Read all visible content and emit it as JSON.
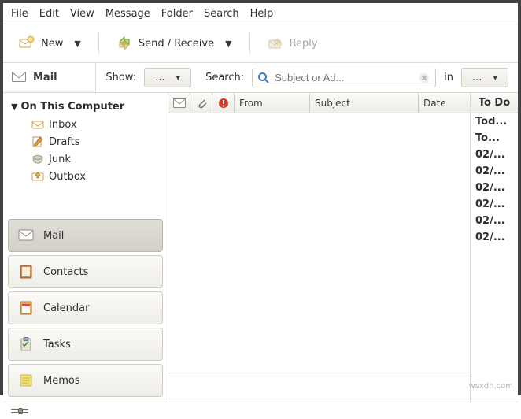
{
  "menu": {
    "file": "File",
    "edit": "Edit",
    "view": "View",
    "message": "Message",
    "folder": "Folder",
    "search": "Search",
    "help": "Help"
  },
  "toolbar": {
    "new": "New",
    "sendreceive": "Send / Receive",
    "reply": "Reply"
  },
  "sidebar_header": "Mail",
  "show_label": "Show:",
  "show_value": "...",
  "search_label": "Search:",
  "search_placeholder": "Subject or Ad...",
  "in_label": "in",
  "in_value": "...",
  "tree": {
    "root": "On This Computer",
    "items": [
      {
        "label": "Inbox"
      },
      {
        "label": "Drafts"
      },
      {
        "label": "Junk"
      },
      {
        "label": "Outbox"
      }
    ]
  },
  "switcher": [
    {
      "label": "Mail"
    },
    {
      "label": "Contacts"
    },
    {
      "label": "Calendar"
    },
    {
      "label": "Tasks"
    },
    {
      "label": "Memos"
    }
  ],
  "columns": {
    "from": "From",
    "subject": "Subject",
    "date": "Date"
  },
  "todo": {
    "header": "To Do",
    "items": [
      "Tod...",
      "To...",
      "02/...",
      "02/...",
      "02/...",
      "02/...",
      "02/...",
      "02/..."
    ]
  },
  "watermark": "wsxdn.com"
}
